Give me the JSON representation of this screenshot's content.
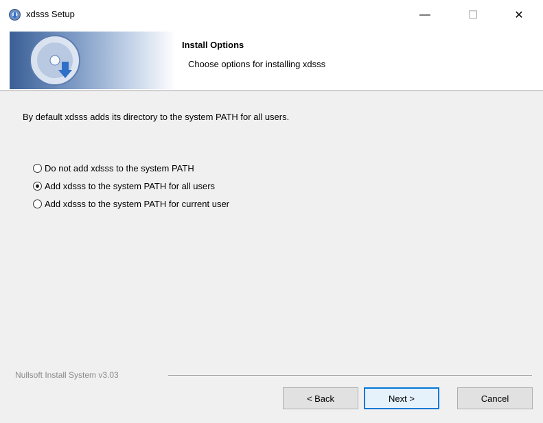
{
  "window": {
    "title": "xdsss Setup",
    "controls": {
      "minimize": "—",
      "maximize": "☐",
      "close": "✕"
    }
  },
  "header": {
    "title": "Install Options",
    "subtitle": "Choose options for installing xdsss"
  },
  "content": {
    "description": "By default xdsss adds its directory to the system PATH for all users.",
    "options": [
      {
        "label": "Do not add xdsss to the system PATH",
        "selected": false
      },
      {
        "label": "Add xdsss to the system PATH for all users",
        "selected": true
      },
      {
        "label": "Add xdsss to the system PATH for current user",
        "selected": false
      }
    ]
  },
  "footer": {
    "branding": "Nullsoft Install System v3.03",
    "buttons": {
      "back": "< Back",
      "next": "Next >",
      "cancel": "Cancel"
    }
  }
}
